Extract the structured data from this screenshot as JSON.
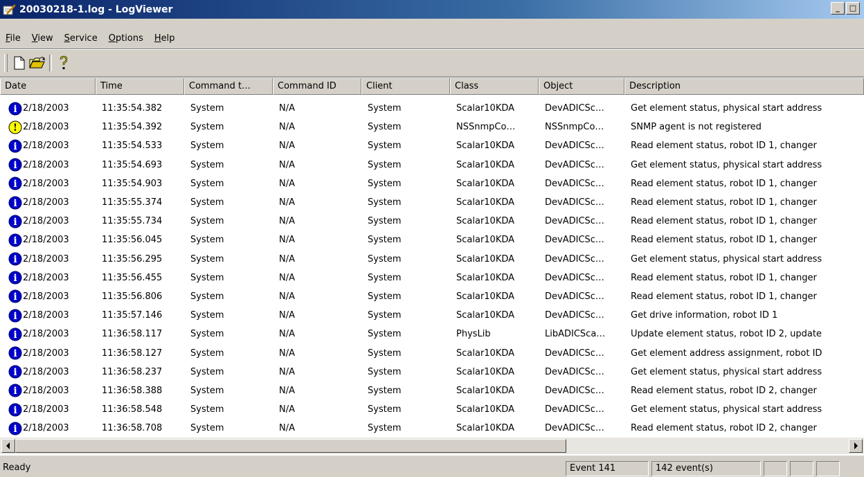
{
  "window": {
    "title": "20030218-1.log - LogViewer",
    "controls": [
      "_",
      "□"
    ]
  },
  "menu": [
    {
      "pre": "",
      "key": "F",
      "post": "ile"
    },
    {
      "pre": "",
      "key": "V",
      "post": "iew"
    },
    {
      "pre": "",
      "key": "S",
      "post": "ervice"
    },
    {
      "pre": "",
      "key": "O",
      "post": "ptions"
    },
    {
      "pre": "",
      "key": "H",
      "post": "elp"
    }
  ],
  "toolbar": {
    "icons": [
      "new-file-icon",
      "open-folder-icon",
      "help-icon"
    ]
  },
  "columns": [
    "Date",
    "Time",
    "Command t…",
    "Command ID",
    "Client",
    "Class",
    "Object",
    "Description"
  ],
  "colors": {
    "info": "#0000cc",
    "warning": "#ffff00",
    "titlebar": "#0a246a"
  },
  "rows": [
    {
      "sev": "info",
      "cells": [
        "2/18/2003",
        "11:35:54.382",
        "System",
        "N/A",
        "System",
        "Scalar10KDA",
        "DevADICSc…",
        "Get element status, physical start address"
      ]
    },
    {
      "sev": "warning",
      "cells": [
        "2/18/2003",
        "11:35:54.392",
        "System",
        "N/A",
        "System",
        "NSSnmpCo…",
        "NSSnmpCo…",
        "SNMP agent is not registered"
      ]
    },
    {
      "sev": "info",
      "cells": [
        "2/18/2003",
        "11:35:54.533",
        "System",
        "N/A",
        "System",
        "Scalar10KDA",
        "DevADICSc…",
        "Read element status, robot ID 1, changer"
      ]
    },
    {
      "sev": "info",
      "cells": [
        "2/18/2003",
        "11:35:54.693",
        "System",
        "N/A",
        "System",
        "Scalar10KDA",
        "DevADICSc…",
        "Get element status, physical start address"
      ]
    },
    {
      "sev": "info",
      "cells": [
        "2/18/2003",
        "11:35:54.903",
        "System",
        "N/A",
        "System",
        "Scalar10KDA",
        "DevADICSc…",
        "Read element status, robot ID 1, changer"
      ]
    },
    {
      "sev": "info",
      "cells": [
        "2/18/2003",
        "11:35:55.374",
        "System",
        "N/A",
        "System",
        "Scalar10KDA",
        "DevADICSc…",
        "Read element status, robot ID 1, changer"
      ]
    },
    {
      "sev": "info",
      "cells": [
        "2/18/2003",
        "11:35:55.734",
        "System",
        "N/A",
        "System",
        "Scalar10KDA",
        "DevADICSc…",
        "Read element status, robot ID 1, changer"
      ]
    },
    {
      "sev": "info",
      "cells": [
        "2/18/2003",
        "11:35:56.045",
        "System",
        "N/A",
        "System",
        "Scalar10KDA",
        "DevADICSc…",
        "Read element status, robot ID 1, changer"
      ]
    },
    {
      "sev": "info",
      "cells": [
        "2/18/2003",
        "11:35:56.295",
        "System",
        "N/A",
        "System",
        "Scalar10KDA",
        "DevADICSc…",
        "Get element status, physical start address"
      ]
    },
    {
      "sev": "info",
      "cells": [
        "2/18/2003",
        "11:35:56.455",
        "System",
        "N/A",
        "System",
        "Scalar10KDA",
        "DevADICSc…",
        "Read element status, robot ID 1, changer"
      ]
    },
    {
      "sev": "info",
      "cells": [
        "2/18/2003",
        "11:35:56.806",
        "System",
        "N/A",
        "System",
        "Scalar10KDA",
        "DevADICSc…",
        "Read element status, robot ID 1, changer"
      ]
    },
    {
      "sev": "info",
      "cells": [
        "2/18/2003",
        "11:35:57.146",
        "System",
        "N/A",
        "System",
        "Scalar10KDA",
        "DevADICSc…",
        "Get drive information, robot ID 1"
      ]
    },
    {
      "sev": "info",
      "cells": [
        "2/18/2003",
        "11:36:58.117",
        "System",
        "N/A",
        "System",
        "PhysLib",
        "LibADICSca…",
        "Update element status, robot ID 2, update"
      ]
    },
    {
      "sev": "info",
      "cells": [
        "2/18/2003",
        "11:36:58.127",
        "System",
        "N/A",
        "System",
        "Scalar10KDA",
        "DevADICSc…",
        "Get element address assignment, robot ID"
      ]
    },
    {
      "sev": "info",
      "cells": [
        "2/18/2003",
        "11:36:58.237",
        "System",
        "N/A",
        "System",
        "Scalar10KDA",
        "DevADICSc…",
        "Get element status, physical start address"
      ]
    },
    {
      "sev": "info",
      "cells": [
        "2/18/2003",
        "11:36:58.388",
        "System",
        "N/A",
        "System",
        "Scalar10KDA",
        "DevADICSc…",
        "Read element status, robot ID 2, changer"
      ]
    },
    {
      "sev": "info",
      "cells": [
        "2/18/2003",
        "11:36:58.548",
        "System",
        "N/A",
        "System",
        "Scalar10KDA",
        "DevADICSc…",
        "Get element status, physical start address"
      ]
    },
    {
      "sev": "info",
      "cells": [
        "2/18/2003",
        "11:36:58.708",
        "System",
        "N/A",
        "System",
        "Scalar10KDA",
        "DevADICSc…",
        "Read element status, robot ID 2, changer"
      ]
    }
  ],
  "status": {
    "ready": "Ready",
    "event": "Event 141",
    "count": "142 event(s)"
  }
}
